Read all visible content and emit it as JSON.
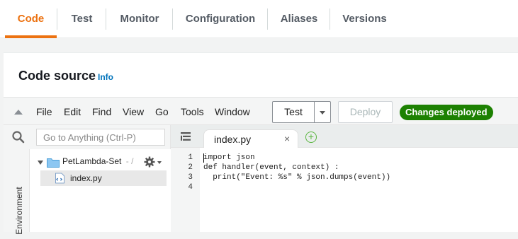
{
  "tabs": [
    "Code",
    "Test",
    "Monitor",
    "Configuration",
    "Aliases",
    "Versions"
  ],
  "code_source": {
    "title": "Code source",
    "info": "Info"
  },
  "menu": [
    "File",
    "Edit",
    "Find",
    "View",
    "Go",
    "Tools",
    "Window"
  ],
  "toolbar": {
    "test_label": "Test",
    "deploy_label": "Deploy",
    "status_badge": "Changes deployed"
  },
  "search": {
    "placeholder": "Go to Anything (Ctrl-P)"
  },
  "environment_label": "Environment",
  "tree": {
    "folder": "PetLambda-Set",
    "folder_suffix": "- /",
    "file": "index.py"
  },
  "editor": {
    "tab_label": "index.py",
    "close_glyph": "×",
    "line_numbers": [
      "1",
      "2",
      "3",
      "4"
    ],
    "lines": [
      "import json",
      "def handler(event, context) :",
      "  print(\"Event: %s\" % json.dumps(event))",
      ""
    ]
  },
  "colors": {
    "accent": "#ec7211",
    "link": "#0073bb",
    "success": "#1d8102"
  }
}
